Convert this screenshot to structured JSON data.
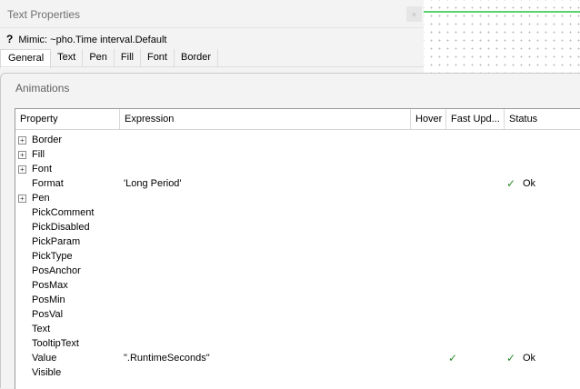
{
  "back_dialog": {
    "title": "Text Properties",
    "close_glyph": "×",
    "mimic_prefix_glyph": "?",
    "mimic_text": "Mimic: ~pho.Time interval.Default",
    "tabs": [
      "General",
      "Text",
      "Pen",
      "Fill",
      "Font",
      "Border"
    ],
    "active_tab": "General"
  },
  "animations": {
    "title": "Animations",
    "columns": {
      "property": "Property",
      "expression": "Expression",
      "hover": "Hover",
      "fast_update": "Fast Upd...",
      "status": "Status"
    },
    "expander_glyph": "+",
    "check_glyph": "✓",
    "rows": [
      {
        "property": "Border",
        "expandable": true,
        "expression": "",
        "hover": false,
        "status": ""
      },
      {
        "property": "Fill",
        "expandable": true,
        "expression": "",
        "hover": false,
        "status": ""
      },
      {
        "property": "Font",
        "expandable": true,
        "expression": "",
        "hover": false,
        "status": ""
      },
      {
        "property": "Format",
        "expandable": false,
        "expression": "'Long Period'",
        "hover": false,
        "status": "Ok"
      },
      {
        "property": "Pen",
        "expandable": true,
        "expression": "",
        "hover": false,
        "status": ""
      },
      {
        "property": "PickComment",
        "expandable": false,
        "expression": "",
        "hover": false,
        "status": ""
      },
      {
        "property": "PickDisabled",
        "expandable": false,
        "expression": "",
        "hover": false,
        "status": ""
      },
      {
        "property": "PickParam",
        "expandable": false,
        "expression": "",
        "hover": false,
        "status": ""
      },
      {
        "property": "PickType",
        "expandable": false,
        "expression": "",
        "hover": false,
        "status": ""
      },
      {
        "property": "PosAnchor",
        "expandable": false,
        "expression": "",
        "hover": false,
        "status": ""
      },
      {
        "property": "PosMax",
        "expandable": false,
        "expression": "",
        "hover": false,
        "status": ""
      },
      {
        "property": "PosMin",
        "expandable": false,
        "expression": "",
        "hover": false,
        "status": ""
      },
      {
        "property": "PosVal",
        "expandable": false,
        "expression": "",
        "hover": false,
        "status": ""
      },
      {
        "property": "Text",
        "expandable": false,
        "expression": "",
        "hover": false,
        "status": ""
      },
      {
        "property": "TooltipText",
        "expandable": false,
        "expression": "",
        "hover": false,
        "status": ""
      },
      {
        "property": "Value",
        "expandable": false,
        "expression": "\".RuntimeSeconds\"",
        "hover": true,
        "status": "Ok"
      },
      {
        "property": "Visible",
        "expandable": false,
        "expression": "",
        "hover": false,
        "status": ""
      }
    ]
  },
  "colors": {
    "canvas_line": "#5ad36b",
    "status_ok": "#2f8a2f"
  }
}
